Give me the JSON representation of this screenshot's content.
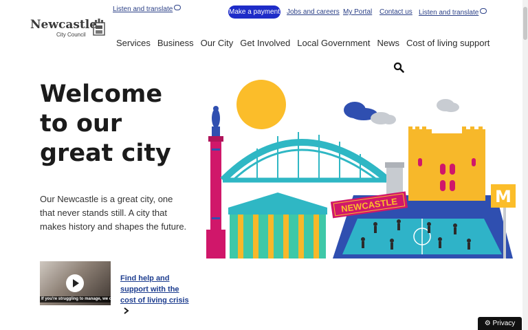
{
  "header": {
    "logo_line1": "Newcastle",
    "logo_line2": "City Council",
    "top_translate": "Listen and translate",
    "utility": {
      "payment": "Make a payment",
      "jobs": "Jobs and careers",
      "portal": "My Portal",
      "contact": "Contact us",
      "translate": "Listen and translate"
    },
    "nav": [
      "Services",
      "Business",
      "Our City",
      "Get Involved",
      "Local Government",
      "News",
      "Cost of living support"
    ]
  },
  "hero": {
    "title_lines": [
      "Welcome",
      "to our",
      "great city"
    ],
    "body": "Our Newcastle is a great city, one that never stands still. A city that makes history and shapes the future.",
    "illustration_sign": "NEWCASTLE",
    "metro_letter": "M"
  },
  "promo": {
    "video_caption": "If you're struggling to manage, we offer a range of advice and support.",
    "link_text": "Find help and support with the cost of living crisis"
  },
  "privacy_label": "Privacy",
  "colors": {
    "brand_blue": "#1e2cc8",
    "link_blue": "#1d3d8f",
    "sun": "#fbbd2a",
    "bridge": "#2fb7c4",
    "monument": "#d0176a",
    "castle": "#f7b82a",
    "pitch": "#2fb3c8"
  }
}
